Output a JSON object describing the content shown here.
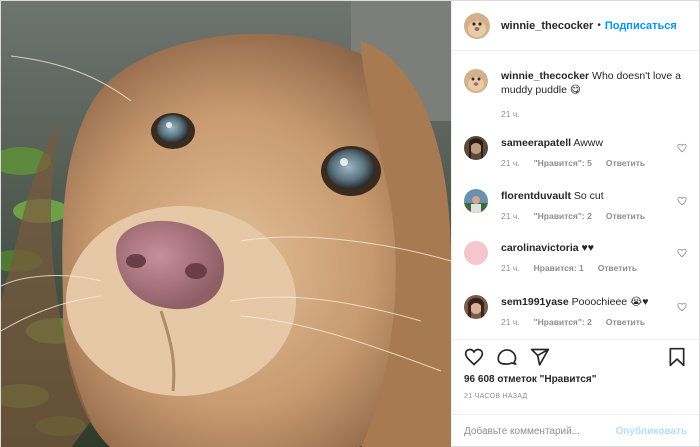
{
  "header": {
    "username": "winnie_thecocker",
    "separator": "•",
    "follow_label": "Подписаться"
  },
  "caption": {
    "username": "winnie_thecocker",
    "text": "Who doesn't love a muddy puddle 😋",
    "time": "21 ч."
  },
  "comments": [
    {
      "username": "sameerapatell",
      "text": "Awww",
      "time": "21 ч.",
      "likes": "\"Нравится\": 5",
      "reply": "Ответить",
      "avatar_color": "#5a4a3a"
    },
    {
      "username": "florentduvault",
      "text": "So cut",
      "time": "21 ч.",
      "likes": "\"Нравится\": 2",
      "reply": "Ответить",
      "avatar_color": "#6a90b0"
    },
    {
      "username": "carolinavictoria",
      "text": "♥♥",
      "time": "21 ч.",
      "likes": "Нравится: 1",
      "reply": "Ответить",
      "avatar_color": "#f5c6cd"
    },
    {
      "username": "sem1991yase",
      "text": "Pooochieee 😭♥",
      "time": "21 ч.",
      "likes": "\"Нравится\": 2",
      "reply": "Ответить",
      "avatar_color": "#7a5a48"
    }
  ],
  "likes_count": "96 608 отметок \"Нравится\"",
  "timestamp": "21 ЧАСОВ НАЗАД",
  "add_comment": {
    "placeholder": "Добавьте комментарий...",
    "publish_label": "Опубликовать"
  },
  "icons": {
    "like": "heart-icon",
    "comment": "comment-icon",
    "share": "share-icon",
    "save": "bookmark-icon"
  }
}
